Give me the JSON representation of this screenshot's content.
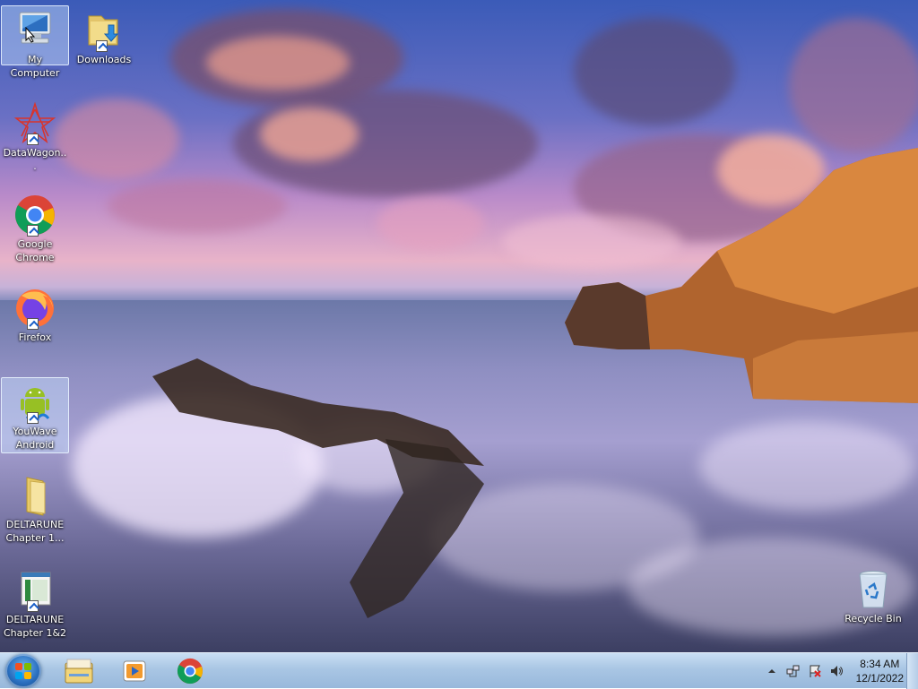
{
  "desktop": {
    "icons": [
      {
        "label": "My Computer",
        "icon": "computer-icon",
        "selected": true
      },
      {
        "label": "Downloads",
        "icon": "downloads-folder-icon"
      },
      {
        "label": "DataWagon...",
        "icon": "datawagon-icon"
      },
      {
        "label": "Google Chrome",
        "icon": "chrome-icon"
      },
      {
        "label": "Firefox",
        "icon": "firefox-icon"
      },
      {
        "label": "YouWave Android",
        "icon": "android-icon",
        "selected": true
      },
      {
        "label": "DELTARUNE Chapter 1...",
        "icon": "folder-icon"
      },
      {
        "label": "DELTARUNE Chapter 1&2",
        "icon": "deltarune-app-icon"
      },
      {
        "label": "Recycle Bin",
        "icon": "recycle-bin-icon"
      }
    ]
  },
  "taskbar": {
    "start": "start-orb-icon",
    "pinned": [
      {
        "name": "Windows Explorer",
        "icon": "explorer-folder-icon"
      },
      {
        "name": "Windows Media Player",
        "icon": "media-player-icon"
      },
      {
        "name": "Google Chrome",
        "icon": "chrome-icon"
      }
    ],
    "tray": {
      "icons": [
        "show-hidden-icons-arrow",
        "network-icon",
        "action-center-flag-icon",
        "volume-icon"
      ],
      "time": "8:34 AM",
      "date": "12/1/2022"
    }
  },
  "colors": {
    "taskbar": "#a9c6e4",
    "selection": "#c8e1ff",
    "accent_blue": "#2a6fbf"
  }
}
